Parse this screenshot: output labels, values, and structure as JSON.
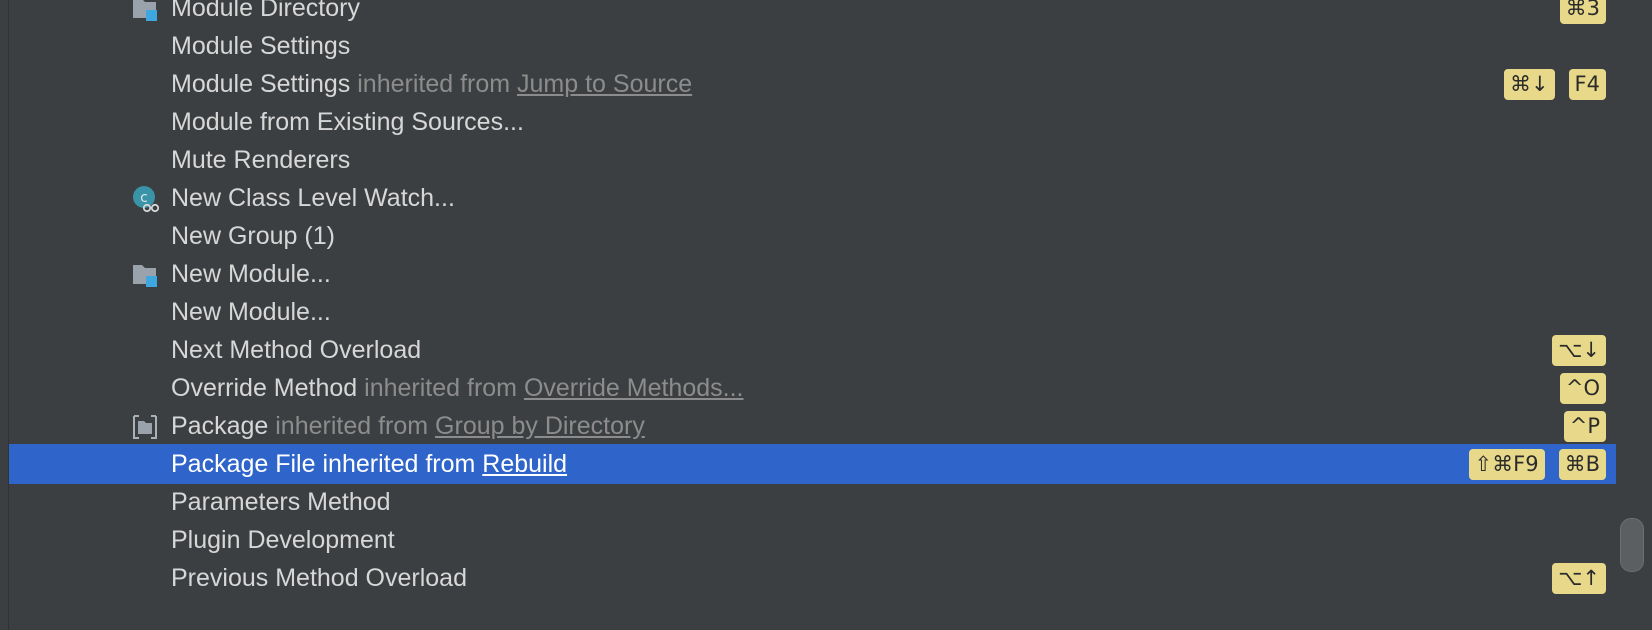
{
  "rows": [
    {
      "name": "Module Directory",
      "icon": "module-folder-icon",
      "shortcuts": [
        "⌘3"
      ]
    },
    {
      "name": "Module Settings",
      "icon": null,
      "shortcuts": []
    },
    {
      "name": "Module Settings",
      "inherited_label": "inherited from",
      "link": "Jump to Source",
      "icon": null,
      "shortcuts": [
        "⌘↓",
        "F4"
      ]
    },
    {
      "name": "Module from Existing Sources...",
      "icon": null,
      "shortcuts": []
    },
    {
      "name": "Mute Renderers",
      "icon": null,
      "shortcuts": []
    },
    {
      "name": "New Class Level Watch...",
      "icon": "class-watch-icon",
      "shortcuts": []
    },
    {
      "name": "New Group (1)",
      "icon": null,
      "shortcuts": []
    },
    {
      "name": "New Module...",
      "icon": "module-folder-icon",
      "shortcuts": []
    },
    {
      "name": "New Module...",
      "icon": null,
      "shortcuts": []
    },
    {
      "name": "Next Method Overload",
      "icon": null,
      "shortcuts": [
        "⌥↓"
      ]
    },
    {
      "name": "Override Method",
      "inherited_label": "inherited from",
      "link": "Override Methods...",
      "icon": null,
      "shortcuts": [
        "^O"
      ]
    },
    {
      "name": "Package",
      "inherited_label": "inherited from",
      "link": "Group by Directory",
      "icon": "package-icon",
      "shortcuts": [
        "^P"
      ]
    },
    {
      "name": "Package File",
      "inherited_label": "inherited from",
      "link": "Rebuild",
      "icon": null,
      "shortcuts": [
        "⇧⌘F9",
        "⌘B"
      ],
      "selected": true
    },
    {
      "name": "Parameters Method",
      "icon": null,
      "shortcuts": []
    },
    {
      "name": "Plugin Development",
      "icon": null,
      "shortcuts": []
    },
    {
      "name": "Previous Method Overload",
      "icon": null,
      "shortcuts": [
        "⌥↑"
      ]
    }
  ],
  "colors": {
    "background": "#3c3f41",
    "selection": "#2f65ca",
    "text": "#d7d7d7",
    "inherited_text": "#8c8c8c",
    "shortcut_badge": "#e8d98a"
  }
}
